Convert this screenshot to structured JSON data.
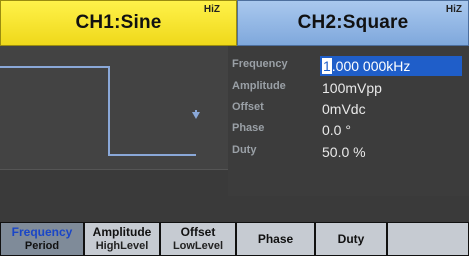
{
  "tabs": {
    "ch1": {
      "label": "CH1:Sine",
      "impedance": "HiZ"
    },
    "ch2": {
      "label": "CH2:Square",
      "impedance": "HiZ"
    }
  },
  "params": [
    {
      "label": "Frequency",
      "value_first": "1",
      "value_rest": ".000 000kHz",
      "selected": true
    },
    {
      "label": "Amplitude",
      "value": "100mVpp"
    },
    {
      "label": "Offset",
      "value": "0mVdc"
    },
    {
      "label": "Phase",
      "value": "0.0 °"
    },
    {
      "label": "Duty",
      "value": "50.0 %"
    }
  ],
  "softkeys": [
    {
      "top": "Frequency",
      "bottom": "Period",
      "active": true
    },
    {
      "top": "Amplitude",
      "bottom": "HighLevel"
    },
    {
      "top": "Offset",
      "bottom": "LowLevel"
    },
    {
      "label": "Phase"
    },
    {
      "label": "Duty"
    },
    {
      "label": ""
    }
  ],
  "colors": {
    "ch1_tab": "#efd81a",
    "ch2_tab": "#7fa8dc",
    "selection": "#1f5ec9",
    "waveform": "#8aa8d8"
  }
}
